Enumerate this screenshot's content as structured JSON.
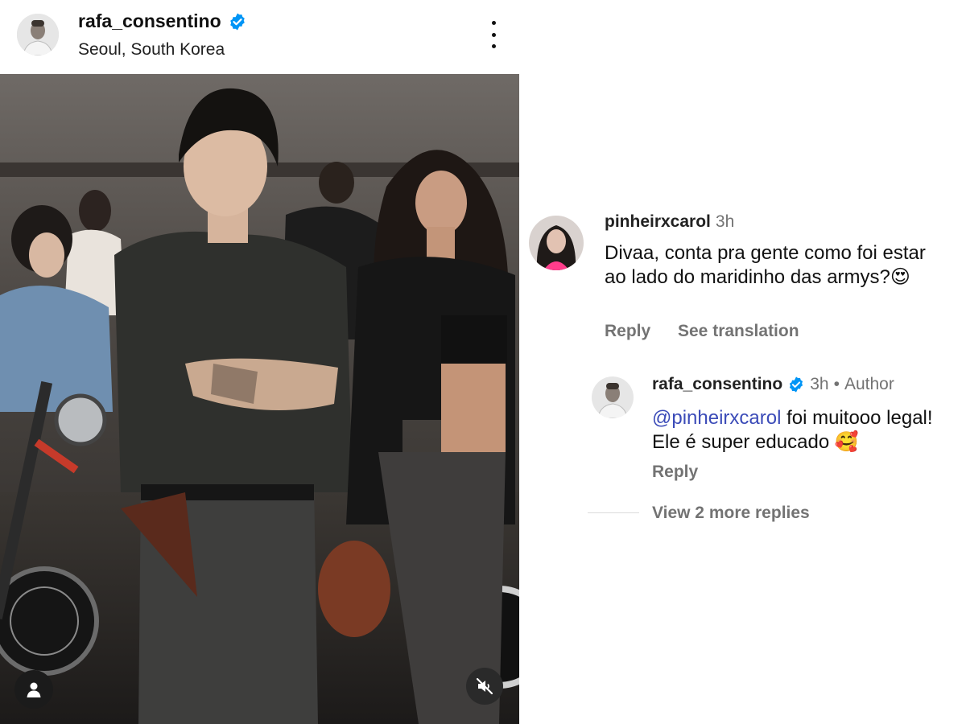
{
  "post": {
    "username": "rafa_consentino",
    "location": "Seoul, South Korea",
    "verified": true,
    "icons": {
      "more": "more-vertical-icon",
      "tag": "person-tag-icon",
      "mute": "speaker-muted-icon",
      "verified": "verified-badge-icon"
    }
  },
  "comment": {
    "username": "pinheirxcarol",
    "time": "3h",
    "text": "Divaa, conta pra gente como foi estar ao lado do maridinho das armys?😍",
    "reply_label": "Reply",
    "translate_label": "See translation"
  },
  "reply": {
    "username": "rafa_consentino",
    "time": "3h",
    "separator": "•",
    "author_label": "Author",
    "mention": "@pinheirxcarol",
    "text": " foi muitooo legal! Ele é super educado 🥰",
    "reply_label": "Reply"
  },
  "view_more_replies": "View 2 more replies",
  "colors": {
    "verified_blue": "#0095f6",
    "mention_blue": "#3b4bb8",
    "secondary_text": "#737373"
  }
}
